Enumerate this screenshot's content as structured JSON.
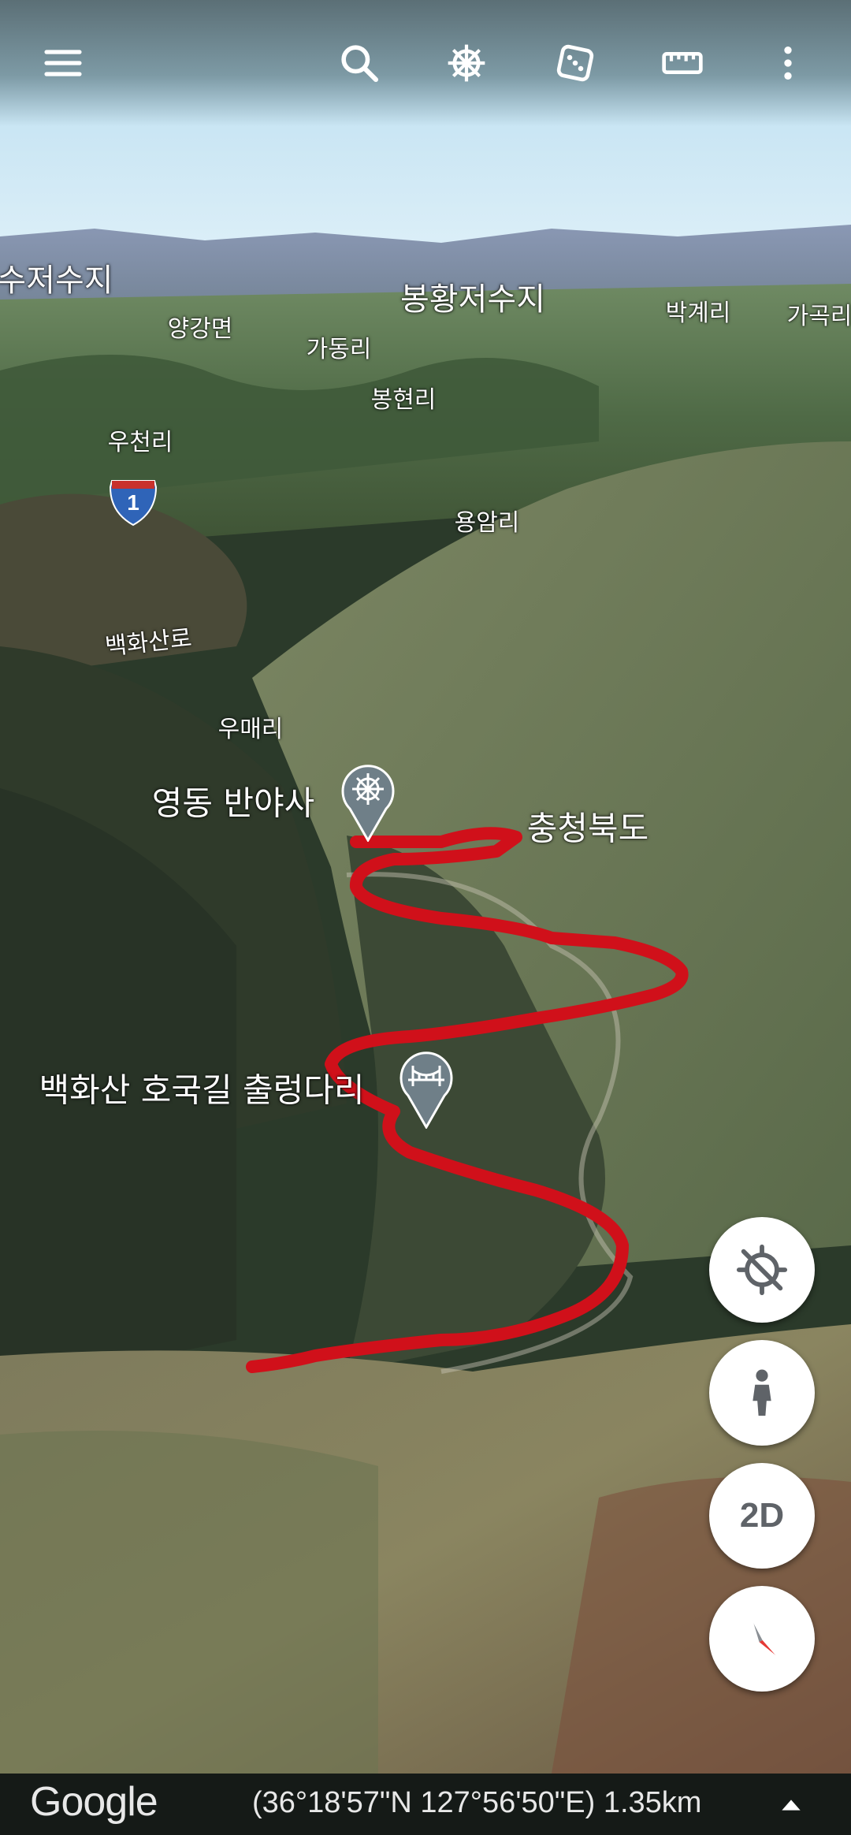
{
  "toolbar": {
    "menu_icon": "hamburger-menu-icon",
    "search_icon": "search-icon",
    "voyager_icon": "ship-wheel-icon",
    "feeling_lucky_icon": "dice-icon",
    "measure_icon": "ruler-icon",
    "more_icon": "more-vert-icon"
  },
  "map": {
    "labels": {
      "reservoir_left": "수저수지",
      "yanggang": "양강면",
      "bonghwang": "봉황저수지",
      "gadong": "가동리",
      "bakgye": "박계리",
      "gagok": "가곡리",
      "bonghyeon": "봉현리",
      "ucheon": "우천리",
      "yongam": "용암리",
      "baekhwasan_ro": "백화산로",
      "umae": "우매리",
      "chungbuk": "충청북도"
    },
    "highway_shield": "1",
    "places": {
      "temple": {
        "name": "영동 반야사",
        "icon": "ship-wheel-icon"
      },
      "bridge": {
        "name": "백화산 호국길 출렁다리",
        "icon": "bridge-icon"
      }
    },
    "route_color": "#d0101a"
  },
  "controls": {
    "location_icon": "location-disabled-icon",
    "pegman_icon": "pegman-icon",
    "mode_2d": "2D",
    "compass_icon": "compass-icon"
  },
  "footer": {
    "logo": "Google",
    "coordinates": "(36°18'57\"N 127°56'50\"E) 1.35km",
    "expand_icon": "expand-up-icon"
  }
}
